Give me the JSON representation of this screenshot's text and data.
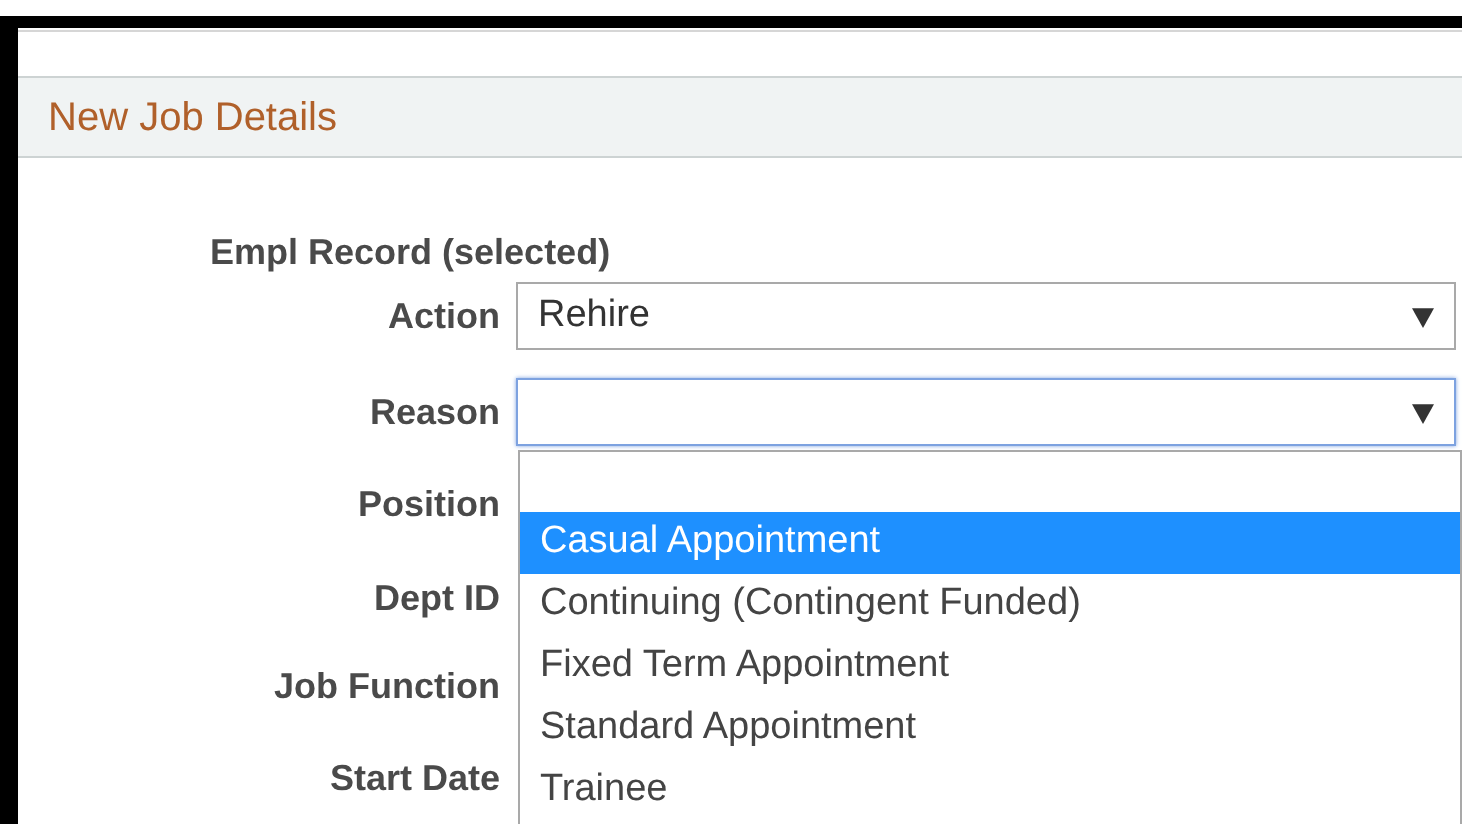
{
  "section": {
    "title": "New Job Details"
  },
  "record_heading": "Empl Record (selected)",
  "fields": [
    {
      "label": "Action",
      "value": "Rehire",
      "focused": false
    },
    {
      "label": "Reason",
      "focused": true
    }
  ],
  "more_labels": [
    "Position",
    "Dept ID",
    "Job Function",
    "Start Date"
  ],
  "dropdown": {
    "options": [
      {
        "label": "Casual Appointment",
        "selected": true
      },
      {
        "label": "Continuing (Contingent Funded)",
        "selected": false
      },
      {
        "label": "Fixed Term Appointment",
        "selected": false
      },
      {
        "label": "Standard Appointment",
        "selected": false
      },
      {
        "label": "Trainee",
        "selected": false
      }
    ]
  }
}
